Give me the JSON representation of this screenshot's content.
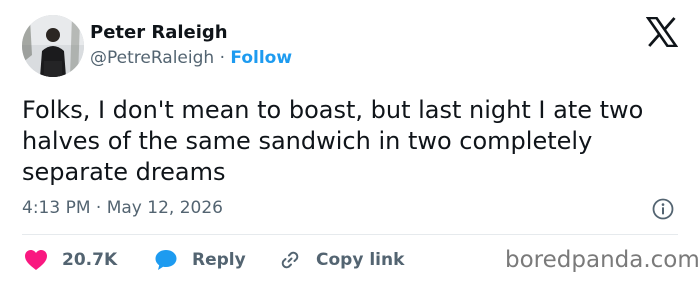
{
  "author": {
    "display_name": "Peter Raleigh",
    "handle": "@PetreRaleigh",
    "separator": "·",
    "follow_label": "Follow"
  },
  "tweet": {
    "text": "Folks, I don't mean to boast, but last night I ate two halves of the same sandwich in two completely separate dreams",
    "timestamp": "4:13 PM · May 12, 2026"
  },
  "actions": {
    "likes": "20.7K",
    "reply_label": "Reply",
    "copy_link_label": "Copy link"
  },
  "watermark": "boredpanda.com",
  "icons": {
    "logo": "x-logo-icon",
    "info": "info-icon",
    "like": "heart-icon",
    "reply": "speech-bubble-icon",
    "link": "link-icon"
  },
  "colors": {
    "accent": "#1d9bf0",
    "like": "#f91880",
    "text": "#0f1419",
    "muted": "#536471"
  }
}
